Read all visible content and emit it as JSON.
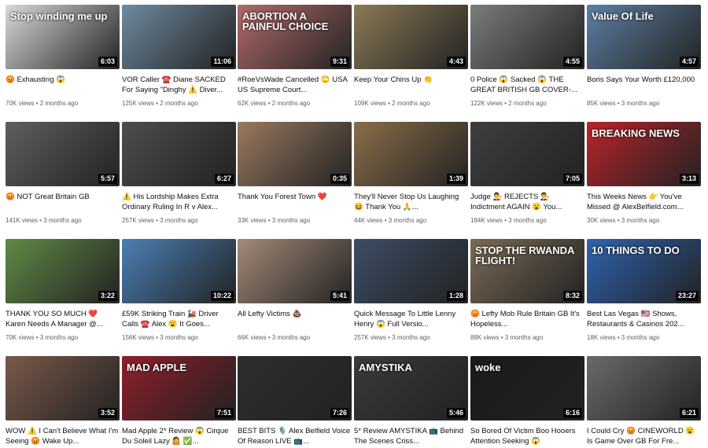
{
  "videos": [
    {
      "title": "😡 Exhausting 😱",
      "views": "70K views",
      "age": "2 months ago",
      "duration": "6:03",
      "bg": "#d9d9d9",
      "overlay": "Stop winding me up",
      "thumb_icon": "puzzle-figures-thumbnail"
    },
    {
      "title": "VOR Caller ☎️ Diane SACKED For Saying \"Dinghy ⚠️ Diver...",
      "views": "125K views",
      "age": "2 months ago",
      "duration": "11:06",
      "bg": "#6f8aa0",
      "overlay": "",
      "thumb_icon": "boat-migrants-thumbnail"
    },
    {
      "title": "#RoeVsWade Cancelled 🙄 USA US Supreme Court...",
      "views": "62K views",
      "age": "2 months ago",
      "duration": "9:31",
      "bg": "#b26a6a",
      "overlay": "ABORTION A PAINFUL CHOICE",
      "thumb_icon": "protest-sign-thumbnail"
    },
    {
      "title": "Keep Your Chins Up 👏",
      "views": "109K views",
      "age": "2 months ago",
      "duration": "4:43",
      "bg": "#8a7a55",
      "overlay": "",
      "thumb_icon": "children-dog-thumbnail"
    },
    {
      "title": "0 Police 😱 Sacked 😱 THE GREAT BRITISH GB COVER-...",
      "views": "122K views",
      "age": "2 months ago",
      "duration": "4:55",
      "bg": "#7b7b7b",
      "overlay": "",
      "thumb_icon": "mugshots-thumbnail"
    },
    {
      "title": "Boris Says Your Worth £120,000",
      "views": "85K views",
      "age": "3 months ago",
      "duration": "4:57",
      "bg": "#5c7fa3",
      "overlay": "Value Of Life",
      "thumb_icon": "value-of-life-thumbnail"
    },
    {
      "title": "😡 NOT Great Britain GB",
      "views": "141K views",
      "age": "3 months ago",
      "duration": "5:57",
      "bg": "#5f5f5f",
      "overlay": "",
      "thumb_icon": "train-rmt-thumbnail"
    },
    {
      "title": "⚠️ His Lordship Makes Extra Ordinary Ruling In R v Alex...",
      "views": "257K views",
      "age": "3 months ago",
      "duration": "6:27",
      "bg": "#4e4e4e",
      "overlay": "",
      "thumb_icon": "lordship-thumbnail"
    },
    {
      "title": "Thank You Forest Town ❤️",
      "views": "33K views",
      "age": "3 months ago",
      "duration": "0:35",
      "bg": "#9a7a60",
      "overlay": "",
      "thumb_icon": "forest-town-thumbnail"
    },
    {
      "title": "They'll Never Stop Us Laughing 😆 Thank You 🙏...",
      "views": "44K views",
      "age": "3 months ago",
      "duration": "1:39",
      "bg": "#8a6d4a",
      "overlay": "",
      "thumb_icon": "laughing-crowd-thumbnail"
    },
    {
      "title": "Judge 👨‍⚖️ REJECTS 👨‍⚖️ Indictment AGAIN 😮 You...",
      "views": "184K views",
      "age": "3 months ago",
      "duration": "7:05",
      "bg": "#3f3f3f",
      "overlay": "",
      "thumb_icon": "judge-statue-thumbnail"
    },
    {
      "title": "This Weeks News 👉 You've Missed @ AlexBelfield.com...",
      "views": "30K views",
      "age": "3 months ago",
      "duration": "3:13",
      "bg": "#b8242a",
      "overlay": "BREAKING NEWS",
      "thumb_icon": "breaking-news-thumbnail"
    },
    {
      "title": "THANK YOU SO MUCH ❤️ Karen Needs A Manager @...",
      "views": "70K views",
      "age": "3 months ago",
      "duration": "3:22",
      "bg": "#5f8a45",
      "overlay": "",
      "thumb_icon": "park-selfie-thumbnail"
    },
    {
      "title": "£59K Striking Train 🚂 Driver Calls ☎️ Alex 😮 It Goes...",
      "views": "156K views",
      "age": "3 months ago",
      "duration": "10:22",
      "bg": "#4a7fb5",
      "overlay": "",
      "thumb_icon": "train-driver-thumbnail"
    },
    {
      "title": "All Lefty Victims 💩",
      "views": "66K views",
      "age": "3 months ago",
      "duration": "5:41",
      "bg": "#a58a78",
      "overlay": "",
      "thumb_icon": "portrait-thumbnail"
    },
    {
      "title": "Quick Message To Little Lenny Henry 😱 Full Versio...",
      "views": "257K views",
      "age": "3 months ago",
      "duration": "1:28",
      "bg": "#3d4d66",
      "overlay": "",
      "thumb_icon": "lenny-henry-thumbnail"
    },
    {
      "title": "😡 Lefty Mob Rule Britain GB It's Hopeless...",
      "views": "88K views",
      "age": "3 months ago",
      "duration": "8:32",
      "bg": "#7a6a55",
      "overlay": "STOP THE RWANDA FLIGHT!",
      "thumb_icon": "rwanda-sign-thumbnail"
    },
    {
      "title": "Best Las Vegas 🇺🇸 Shows, Restaurants & Casinos 202...",
      "views": "18K views",
      "age": "3 months ago",
      "duration": "23:27",
      "bg": "#2f63b0",
      "overlay": "10 THINGS TO DO",
      "thumb_icon": "las-vegas-thumbnail"
    },
    {
      "title": "WOW ⚠️ I Can't Believe What I'm Seeing 😡 Wake Up...",
      "views": "",
      "age": "",
      "duration": "3:52",
      "bg": "#7a5a4a",
      "overlay": "",
      "thumb_icon": "bearded-man-thumbnail"
    },
    {
      "title": "Mad Apple 2* Review 😱 Cirque Du Soleil Lazy 🤷 ✅...",
      "views": "",
      "age": "",
      "duration": "7:51",
      "bg": "#8e1f2a",
      "overlay": "MAD APPLE",
      "thumb_icon": "mad-apple-thumbnail"
    },
    {
      "title": "BEST BITS 🎙️ Alex Belfield Voice Of Reason LIVE 📺...",
      "views": "",
      "age": "",
      "duration": "7:26",
      "bg": "#2e2e2e",
      "overlay": "",
      "thumb_icon": "best-bits-thumbnail"
    },
    {
      "title": "5* Review AMYSTIKA 📺 Behind The Scenes Criss...",
      "views": "",
      "age": "",
      "duration": "5:46",
      "bg": "#3a3a3a",
      "overlay": "AMYSTIKA",
      "thumb_icon": "amystika-thumbnail"
    },
    {
      "title": "So Bored Of Victim Boo Hooers Attention Seeking 😱",
      "views": "",
      "age": "",
      "duration": "6:16",
      "bg": "#1a1a1a",
      "overlay": "woke",
      "thumb_icon": "woke-thumbnail"
    },
    {
      "title": "I Could Cry 😡 CINEWORLD 😮 Is Game Over GB For Fre...",
      "views": "",
      "age": "",
      "duration": "6:21",
      "bg": "#6a6a6a",
      "overlay": "",
      "thumb_icon": "cineworld-thumbnail"
    }
  ]
}
